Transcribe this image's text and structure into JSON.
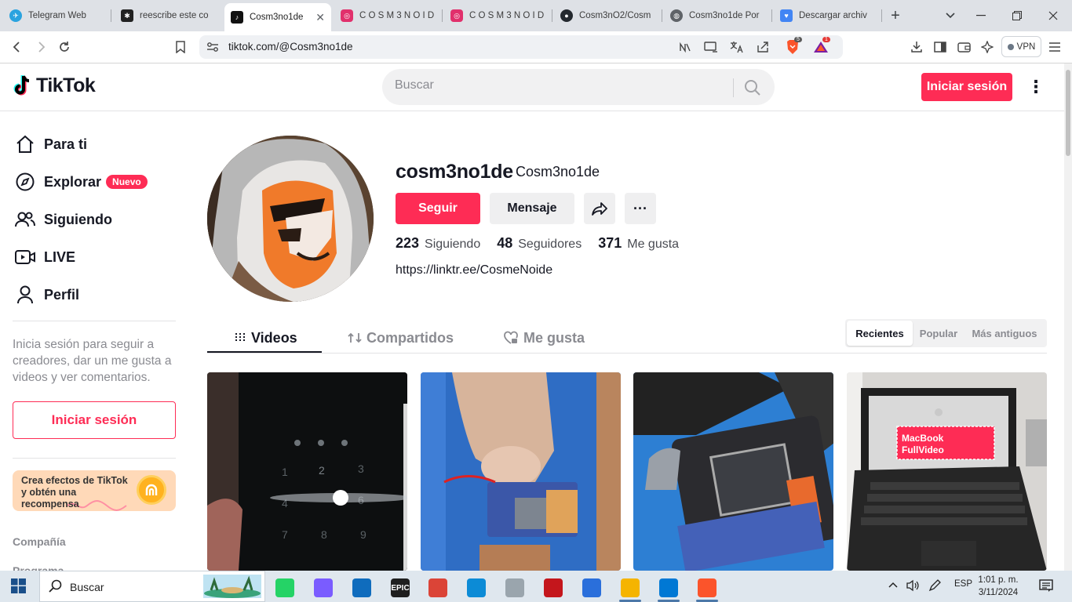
{
  "browser": {
    "tabs": [
      {
        "title": "Telegram Web",
        "color": "#2aa3df",
        "glyph": "✈"
      },
      {
        "title": "reescribe este co",
        "color": "#222222",
        "glyph": "✱"
      },
      {
        "title": "Cosm3no1de",
        "color": "#111111",
        "glyph": "♪",
        "active": true
      },
      {
        "title": "C O S M 3 N O I D",
        "color": "#e1306c",
        "glyph": "◎"
      },
      {
        "title": "C O S M 3 N O I D",
        "color": "#e1306c",
        "glyph": "◎"
      },
      {
        "title": "Cosm3nO2/Cosm",
        "color": "#24292f",
        "glyph": "●"
      },
      {
        "title": "Cosm3no1de Por",
        "color": "#5f6368",
        "glyph": "◍"
      },
      {
        "title": "Descargar archiv",
        "color": "#4285f4",
        "glyph": "♥"
      }
    ],
    "close_glyph": "✕",
    "new_tab_glyph": "+",
    "url": "tiktok.com/@Cosm3no1de",
    "vpn_label": "VPN",
    "brave_badge": "5",
    "alert_badge": "1"
  },
  "header": {
    "logo_text": "TikTok",
    "search_placeholder": "Buscar",
    "login_label": "Iniciar sesión",
    "more_glyph": "⋮"
  },
  "sidebar": {
    "items": [
      {
        "label": "Para ti",
        "icon": "home-icon"
      },
      {
        "label": "Explorar",
        "icon": "compass-icon",
        "badge": "Nuevo"
      },
      {
        "label": "Siguiendo",
        "icon": "users-icon"
      },
      {
        "label": "LIVE",
        "icon": "live-icon"
      },
      {
        "label": "Perfil",
        "icon": "person-icon"
      }
    ],
    "prompt": "Inicia sesión para seguir a creadores, dar un me gusta a videos y ver comentarios.",
    "login_label": "Iniciar sesión",
    "effects_text": "Crea efectos de TikTok y obtén una recompensa",
    "footer": [
      "Compañía",
      "Programa"
    ]
  },
  "profile": {
    "username": "cosm3no1de",
    "nickname": "Cosm3no1de",
    "follow_label": "Seguir",
    "message_label": "Mensaje",
    "more_glyph": "···",
    "stats": [
      {
        "value": "223",
        "label": "Siguiendo"
      },
      {
        "value": "48",
        "label": "Seguidores"
      },
      {
        "value": "371",
        "label": "Me gusta"
      }
    ],
    "bio_link": "https://linktr.ee/CosmeNoide",
    "tabs": [
      {
        "label": "Videos",
        "glyph": "|||"
      },
      {
        "label": "Compartidos",
        "glyph": "⇅"
      },
      {
        "label": "Me gusta",
        "glyph": "♡"
      }
    ],
    "sort_options": [
      "Recientes",
      "Popular",
      "Más antiguos"
    ],
    "video_overlay_text": "MacBook FullVideo"
  },
  "taskbar": {
    "search_label": "Buscar",
    "lang": "ESP",
    "time": "1:01 p. m.",
    "date": "3/11/2024",
    "apps": [
      {
        "name": "whatsapp-icon",
        "color": "#25d366"
      },
      {
        "name": "copilot-icon",
        "color": "#7a5cff"
      },
      {
        "name": "mail-icon",
        "color": "#0f6cbd"
      },
      {
        "name": "epic-games-icon",
        "color": "#1f1f1f",
        "label": "EPIC"
      },
      {
        "name": "chrome-icon",
        "color": "#db4437"
      },
      {
        "name": "edge-icon",
        "color": "#0c8bd6"
      },
      {
        "name": "photos-icon",
        "color": "#9aa5ad"
      },
      {
        "name": "acrobat-icon",
        "color": "#c4161c"
      },
      {
        "name": "store-icon",
        "color": "#2a6fdb"
      },
      {
        "name": "explorer-icon",
        "color": "#f5b400"
      },
      {
        "name": "vscode-icon",
        "color": "#0078d4"
      },
      {
        "name": "brave-icon",
        "color": "#fb542b"
      }
    ]
  }
}
